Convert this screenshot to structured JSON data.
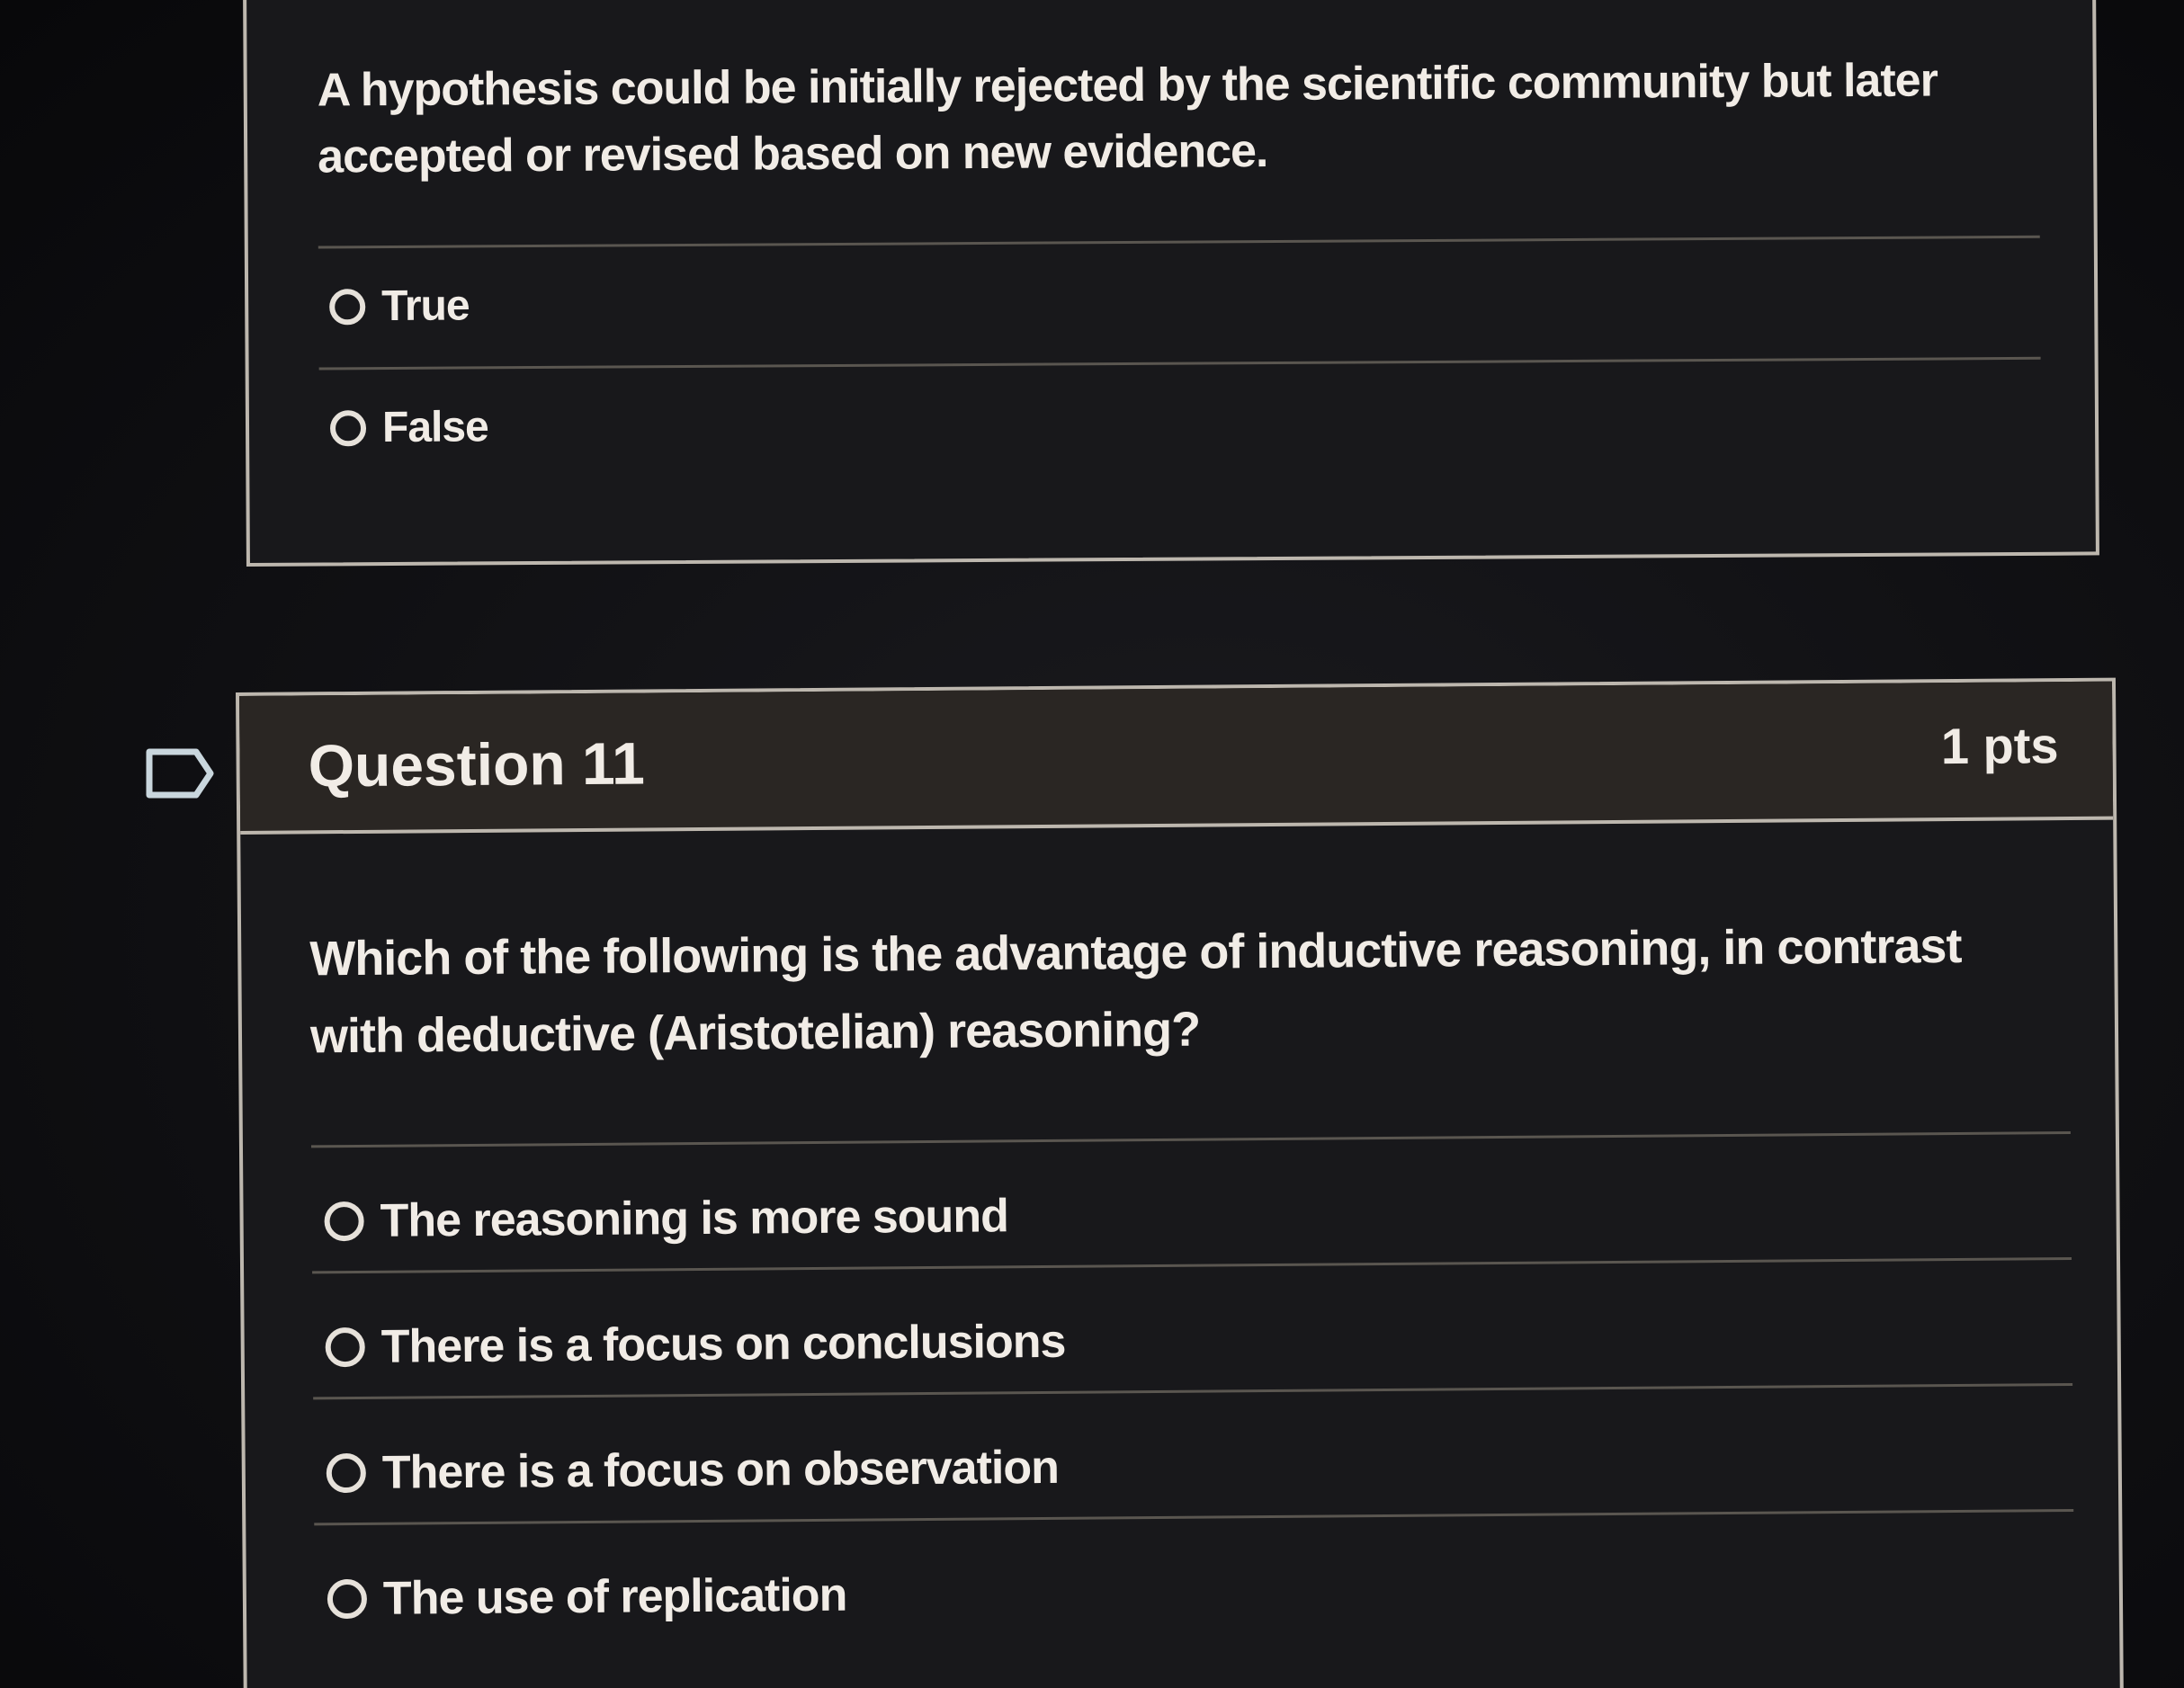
{
  "question10": {
    "text": "A hypothesis could be initially rejected by the scientific community but later accepted or revised based on new evidence.",
    "answers": [
      {
        "label": "True"
      },
      {
        "label": "False"
      }
    ]
  },
  "question11": {
    "title": "Question 11",
    "points": "1 pts",
    "text": "Which of the following is the advantage of inductive reasoning, in contrast with deductive (Aristotelian) reasoning?",
    "answers": [
      {
        "label": "The reasoning is more sound"
      },
      {
        "label": "There is a focus on conclusions"
      },
      {
        "label": "There is a focus on observation"
      },
      {
        "label": "The use of replication"
      }
    ]
  },
  "colors": {
    "background": "#0d0d10",
    "card_border": "#bdb7ae",
    "header_bg": "#2a2623",
    "text": "#f1ece6",
    "flag_stroke": "#c9d6dd"
  },
  "icons": {
    "flag": "bookmark-flag-icon",
    "radio": "radio-unchecked-icon"
  }
}
